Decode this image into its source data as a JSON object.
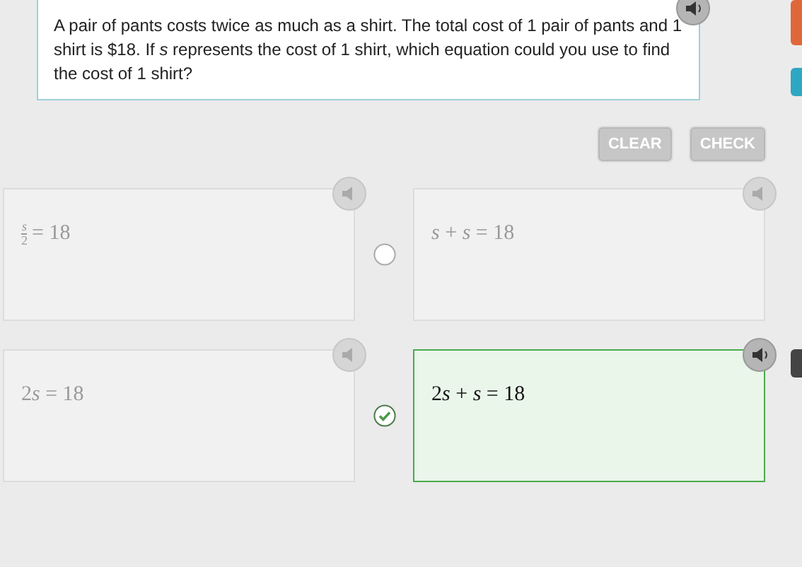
{
  "question": {
    "text": "A pair of pants costs twice as much as a shirt. The total cost of 1 pair of pants and 1 shirt is $18. If *s* represents the cost of 1 shirt, which equation could you use to find the cost of 1 shirt?"
  },
  "buttons": [
    {
      "label": "CLEAR",
      "disabled": true
    },
    {
      "label": "CHECK",
      "disabled": true
    }
  ],
  "options": [
    {
      "kind": "fraction",
      "numerator": "s",
      "denominator": "2",
      "text": "= 18",
      "selected": false
    },
    {
      "kind": "plain",
      "text": "s + s = 18",
      "selected": false
    },
    {
      "kind": "plain",
      "text": "2s = 18",
      "selected": false
    },
    {
      "kind": "plain",
      "text": "2s + s = 18",
      "selected": true
    }
  ]
}
